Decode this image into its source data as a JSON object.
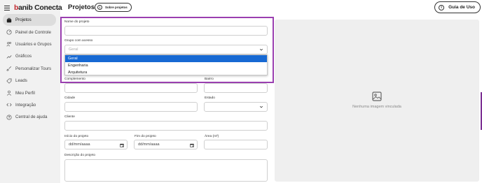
{
  "brand": {
    "logo_prefix": "b",
    "logo_rest": "anib Conecta"
  },
  "sidebar": {
    "items": [
      {
        "label": "Projetos",
        "icon": "briefcase-icon"
      },
      {
        "label": "Painel de Controle",
        "icon": "dashboard-icon"
      },
      {
        "label": "Usuários e Grupos",
        "icon": "users-icon"
      },
      {
        "label": "Gráficos",
        "icon": "chart-icon"
      },
      {
        "label": "Personalizar Tours",
        "icon": "brush-icon"
      },
      {
        "label": "Leads",
        "icon": "tag-icon"
      },
      {
        "label": "Meu Perfil",
        "icon": "user-icon"
      },
      {
        "label": "Integração",
        "icon": "code-icon"
      },
      {
        "label": "Central de ajuda",
        "icon": "help-icon"
      }
    ]
  },
  "header": {
    "title": "Projetos",
    "about_button": "Sobre projetos",
    "guide_button": "Guia de Uso",
    "info_glyph": "i"
  },
  "form": {
    "project_name_label": "Nome do projeto",
    "project_name_value": "",
    "access_group_label": "Grupo com acesso",
    "access_group_value": "Geral",
    "access_group_options": [
      "Geral",
      "Engenharia",
      "Arquitetura"
    ],
    "complement_label": "Complemento",
    "neighborhood_label": "Bairro",
    "city_label": "Cidade",
    "state_label": "Estado",
    "client_label": "Cliente",
    "start_label": "Início do projeto",
    "start_placeholder": "dd/mm/aaaa",
    "end_label": "Fim do projeto",
    "end_placeholder": "dd/mm/aaaa",
    "area_label": "Área (m²)",
    "description_label": "Descrição do projeto"
  },
  "image_panel": {
    "caption": "Nenhuma imagem vinculada"
  },
  "colors": {
    "brand_red": "#c0282d",
    "highlight": "#9a3fb0",
    "selected_option": "#1769d3",
    "panel_bg": "#efefef"
  }
}
